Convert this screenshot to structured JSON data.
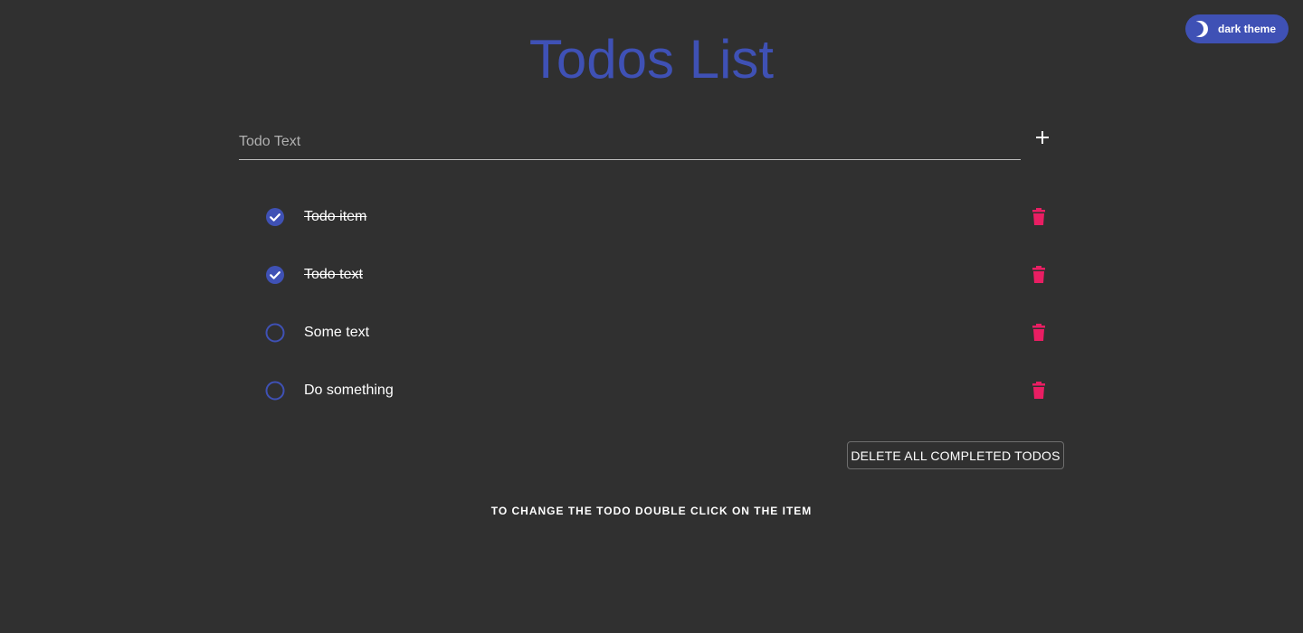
{
  "app": {
    "title": "Todos List",
    "accent_color": "#3f51b5",
    "danger_color": "#e91e63",
    "background_color": "#303030"
  },
  "theme_toggle": {
    "label": "dark theme",
    "icon": "moon-icon"
  },
  "input": {
    "placeholder": "Todo Text",
    "value": "",
    "add_icon": "plus-icon"
  },
  "todos": [
    {
      "text": "Todo item",
      "completed": true
    },
    {
      "text": "Todo text",
      "completed": true
    },
    {
      "text": "Some text",
      "completed": false
    },
    {
      "text": "Do something",
      "completed": false
    }
  ],
  "actions": {
    "delete_completed_label": "DELETE ALL COMPLETED TODOS"
  },
  "hint": "TO CHANGE THE TODO DOUBLE CLICK ON THE ITEM"
}
